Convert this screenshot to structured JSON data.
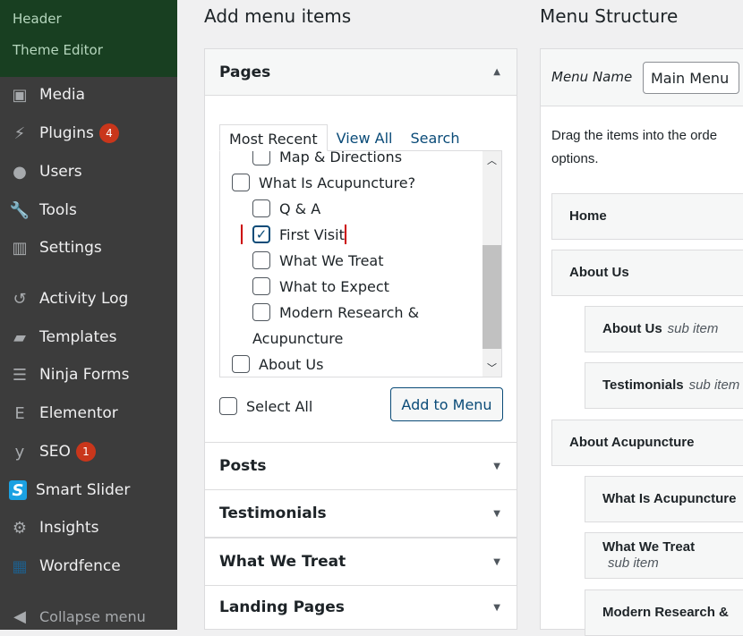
{
  "sidebar": {
    "submenu": [
      "Header",
      "Theme Editor"
    ],
    "items": [
      {
        "label": "Media",
        "icon": "media-icon"
      },
      {
        "label": "Plugins",
        "icon": "plugin-icon",
        "badge": "4"
      },
      {
        "label": "Users",
        "icon": "user-icon"
      },
      {
        "label": "Tools",
        "icon": "wrench-icon"
      },
      {
        "label": "Settings",
        "icon": "settings-icon"
      },
      {
        "label": "Activity Log",
        "icon": "history-icon"
      },
      {
        "label": "Templates",
        "icon": "folder-icon"
      },
      {
        "label": "Ninja Forms",
        "icon": "form-icon"
      },
      {
        "label": "Elementor",
        "icon": "elementor-icon"
      },
      {
        "label": "SEO",
        "icon": "yoast-icon",
        "badge": "1"
      },
      {
        "label": "Smart Slider",
        "icon": "smart-slider-icon"
      },
      {
        "label": "Insights",
        "icon": "insights-icon"
      },
      {
        "label": "Wordfence",
        "icon": "wordfence-icon"
      }
    ],
    "collapse": "Collapse menu"
  },
  "add_items": {
    "title": "Add menu items",
    "pages": {
      "title": "Pages",
      "tabs": [
        "Most Recent",
        "View All",
        "Search"
      ],
      "list": [
        {
          "label": "Map & Directions",
          "checked": false
        },
        {
          "label": "What Is Acupuncture?",
          "checked": false
        },
        {
          "label": "Q & A",
          "checked": false
        },
        {
          "label": "First Visit",
          "checked": true
        },
        {
          "label": "What We Treat",
          "checked": false
        },
        {
          "label": "What to Expect",
          "checked": false
        },
        {
          "label": "Modern Research &",
          "checked": false
        },
        {
          "label": "Acupuncture"
        },
        {
          "label": "About Us",
          "checked": false
        }
      ],
      "select_all": "Select All",
      "add_button": "Add to Menu"
    },
    "sections": [
      "Posts",
      "Testimonials",
      "What We Treat",
      "Landing Pages"
    ]
  },
  "structure": {
    "title": "Menu Structure",
    "menu_name_label": "Menu Name",
    "menu_name_value": "Main Menu",
    "instructions": "Drag the items into the orde",
    "instructions2": "options.",
    "items": [
      {
        "label": "Home",
        "sub": ""
      },
      {
        "label": "About Us",
        "sub": ""
      },
      {
        "label": "About Us",
        "sub": "sub item"
      },
      {
        "label": "Testimonials",
        "sub": "sub item"
      },
      {
        "label": "About Acupuncture",
        "sub": ""
      },
      {
        "label": "What Is Acupuncture",
        "sub": ""
      },
      {
        "label": "What We Treat",
        "sub": "sub item"
      },
      {
        "label": "Modern Research &",
        "sub": ""
      }
    ]
  },
  "colors": {
    "accent": "#0a4b78",
    "badge": "#c9361b",
    "sidebar": "#3c3c3c",
    "submenu": "#183f21"
  }
}
